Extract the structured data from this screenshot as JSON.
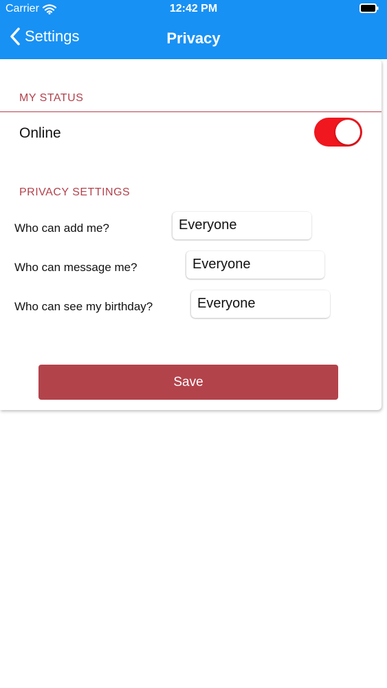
{
  "status_bar": {
    "carrier": "Carrier",
    "time": "12:42 PM",
    "wifi_icon": "wifi-icon",
    "battery_icon": "battery-icon"
  },
  "navbar": {
    "back_label": "Settings",
    "back_icon": "chevron-left-icon",
    "title": "Privacy",
    "color": "#1891f4"
  },
  "my_status": {
    "header": "MY STATUS",
    "online_label": "Online",
    "online_enabled": true
  },
  "privacy_settings": {
    "header": "PRIVACY SETTINGS",
    "rows": [
      {
        "label": "Who can add me?",
        "value": "Everyone"
      },
      {
        "label": "Who can message me?",
        "value": "Everyone"
      },
      {
        "label": "Who can see my birthday?",
        "value": "Everyone"
      }
    ]
  },
  "save_button": {
    "label": "Save",
    "color": "#b3434b"
  },
  "colors": {
    "accent": "#b2414c",
    "toggle_on": "#f0171f"
  }
}
